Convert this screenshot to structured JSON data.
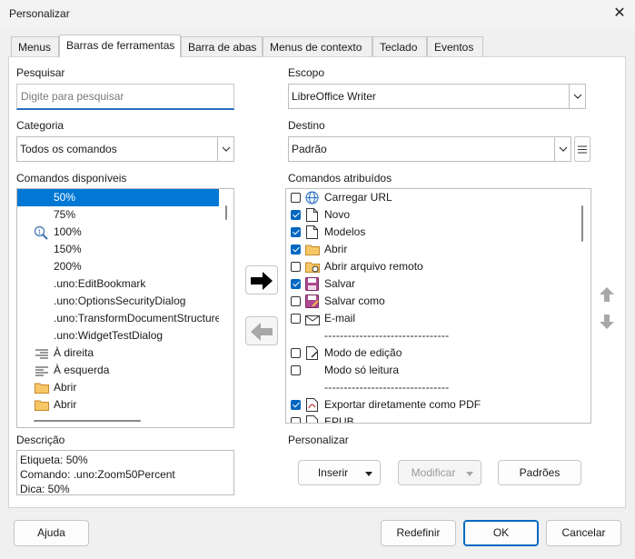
{
  "window": {
    "title": "Personalizar",
    "close_glyph": "✕"
  },
  "tabs": [
    {
      "label": "Menus"
    },
    {
      "label": "Barras de ferramentas"
    },
    {
      "label": "Barra de abas"
    },
    {
      "label": "Menus de contexto"
    },
    {
      "label": "Teclado"
    },
    {
      "label": "Eventos"
    }
  ],
  "active_tab": "Barras de ferramentas",
  "search": {
    "label": "Pesquisar",
    "placeholder": "Digite para pesquisar"
  },
  "category": {
    "label": "Categoria",
    "value": "Todos os comandos"
  },
  "available": {
    "label": "Comandos disponíveis",
    "items": [
      {
        "label": "50%",
        "icon": "zoom-icon",
        "selected": true
      },
      {
        "label": "75%",
        "icon": "zoom-icon"
      },
      {
        "label": "100%",
        "icon": "zoom-100-icon"
      },
      {
        "label": "150%",
        "icon": "zoom-icon"
      },
      {
        "label": "200%",
        "icon": "zoom-icon"
      },
      {
        "label": ".uno:EditBookmark",
        "icon": ""
      },
      {
        "label": ".uno:OptionsSecurityDialog",
        "icon": ""
      },
      {
        "label": ".uno:TransformDocumentStructure",
        "icon": ""
      },
      {
        "label": ".uno:WidgetTestDialog",
        "icon": ""
      },
      {
        "label": "À direita",
        "icon": "align-right-icon"
      },
      {
        "label": "À esquerda",
        "icon": "align-left-icon"
      },
      {
        "label": "Abrir",
        "icon": "folder-icon"
      },
      {
        "label": "Abrir",
        "icon": "folder-icon"
      }
    ]
  },
  "description": {
    "label": "Descrição",
    "lines": [
      "Etiqueta: 50%",
      "Comando: .uno:Zoom50Percent",
      "Dica: 50%"
    ]
  },
  "scope": {
    "label": "Escopo",
    "value": "LibreOffice Writer"
  },
  "target": {
    "label": "Destino",
    "value": "Padrão"
  },
  "assigned": {
    "label": "Comandos atribuídos",
    "items": [
      {
        "label": "Carregar URL",
        "checked": false,
        "icon": "globe-icon"
      },
      {
        "label": "Novo",
        "checked": true,
        "icon": "new-document-icon"
      },
      {
        "label": "Modelos",
        "checked": true,
        "icon": "template-icon"
      },
      {
        "label": "Abrir",
        "checked": true,
        "icon": "folder-icon"
      },
      {
        "label": "Abrir arquivo remoto",
        "checked": false,
        "icon": "remote-folder-icon"
      },
      {
        "label": "Salvar",
        "checked": true,
        "icon": "save-icon"
      },
      {
        "label": "Salvar como",
        "checked": false,
        "icon": "save-as-icon"
      },
      {
        "label": "E-mail",
        "checked": false,
        "icon": "email-icon"
      },
      {
        "label": "--------------------------------",
        "separator": true
      },
      {
        "label": "Modo de edição",
        "checked": false,
        "icon": "edit-mode-icon"
      },
      {
        "label": "Modo só leitura",
        "checked": false,
        "icon": ""
      },
      {
        "label": "--------------------------------",
        "separator": true
      },
      {
        "label": "Exportar diretamente como PDF",
        "checked": true,
        "icon": "pdf-icon"
      },
      {
        "label": "EPUB",
        "checked": false,
        "icon": "epub-icon"
      }
    ]
  },
  "customize": {
    "label": "Personalizar",
    "insert": "Inserir",
    "modify": "Modificar",
    "defaults": "Padrões"
  },
  "footer": {
    "help": "Ajuda",
    "reset": "Redefinir",
    "ok": "OK",
    "cancel": "Cancelar"
  },
  "colors": {
    "accent": "#0067c0",
    "selection": "#0078d4",
    "folder": "#f0b84a",
    "save": "#a0357e"
  }
}
